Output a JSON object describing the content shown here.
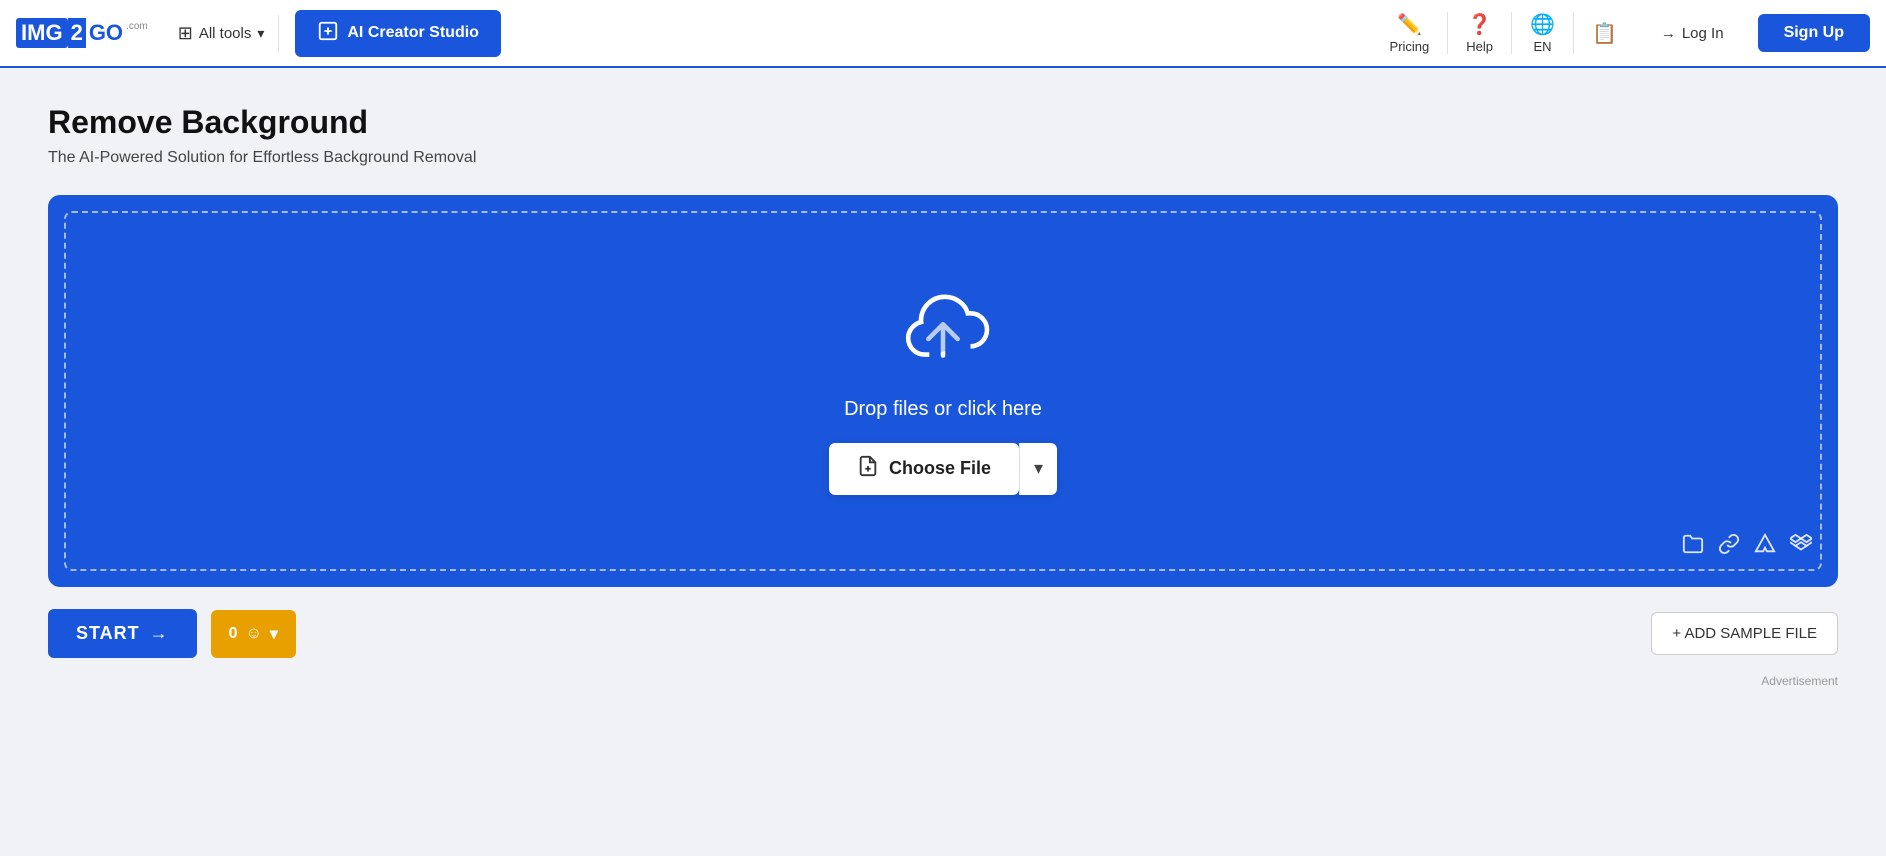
{
  "header": {
    "logo": {
      "img_part": "IMG",
      "two": "2",
      "go": "GO",
      "com": ".com"
    },
    "all_tools_label": "All tools",
    "ai_creator_label": "AI Creator Studio",
    "nav": {
      "pricing": "Pricing",
      "help": "Help",
      "language": "EN",
      "notifications": ""
    },
    "login_label": "Log In",
    "signup_label": "Sign Up"
  },
  "page": {
    "title": "Remove Background",
    "subtitle": "The AI-Powered Solution for Effortless Background Removal",
    "dropzone": {
      "drop_text": "Drop files or click here",
      "choose_file_label": "Choose File"
    },
    "start_label": "START",
    "counter_label": "0",
    "add_sample_label": "+ ADD SAMPLE FILE",
    "advertisement": "Advertisement"
  }
}
